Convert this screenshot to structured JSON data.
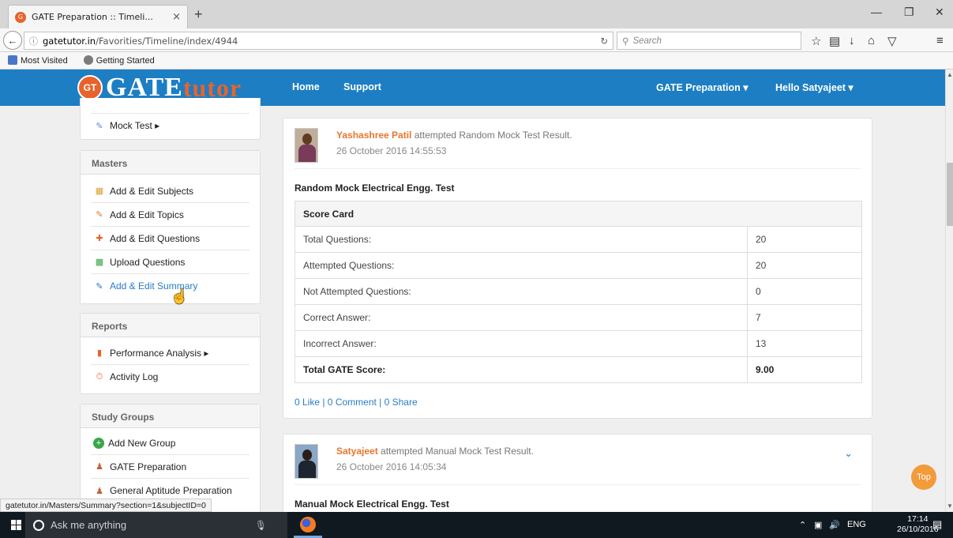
{
  "browser": {
    "tab_title": "GATE Preparation :: Timeli...",
    "tab_close": "×",
    "new_tab": "+",
    "url_host": "gatetutor.in",
    "url_path": "/Favorities/Timeline/index/4944",
    "search_placeholder": "Search",
    "bookmarks": [
      "Most Visited",
      "Getting Started"
    ]
  },
  "site": {
    "logo_badge": "GT",
    "logo_gate": "GATE",
    "logo_tutor": "tutor",
    "nav": {
      "home": "Home",
      "support": "Support",
      "gate_prep": "GATE Preparation ▾",
      "user": "Hello Satyajeet ▾"
    }
  },
  "sidebar": {
    "top_item": "Mock Test ▸",
    "masters": {
      "heading": "Masters",
      "items": [
        "Add & Edit Subjects",
        "Add & Edit Topics",
        "Add & Edit Questions",
        "Upload Questions",
        "Add & Edit Summary"
      ]
    },
    "reports": {
      "heading": "Reports",
      "items": [
        "Performance Analysis ▸",
        "Activity Log"
      ]
    },
    "study_groups": {
      "heading": "Study Groups",
      "items": [
        "Add New Group",
        "GATE Preparation",
        "General Aptitude Preparation"
      ]
    }
  },
  "feed": {
    "post1": {
      "user": "Yashashree Patil",
      "action": " attempted Random Mock Test Result.",
      "timestamp": "26 October 2016 14:55:53",
      "test_title": "Random Mock Electrical Engg. Test",
      "table_header": "Score Card",
      "rows": [
        {
          "label": "Total Questions:",
          "value": "20"
        },
        {
          "label": "Attempted Questions:",
          "value": "20"
        },
        {
          "label": "Not Attempted Questions:",
          "value": "0"
        },
        {
          "label": "Correct Answer:",
          "value": "7"
        },
        {
          "label": "Incorrect Answer:",
          "value": "13"
        },
        {
          "label": "Total GATE Score:",
          "value": "9.00"
        }
      ],
      "actions": "0 Like | 0 Comment | 0 Share"
    },
    "post2": {
      "user": "Satyajeet",
      "action": " attempted Manual Mock Test Result.",
      "timestamp": "26 October 2016 14:05:34",
      "test_title": "Manual Mock Electrical Engg. Test"
    }
  },
  "top_button": "Top",
  "status_url": "gatetutor.in/Masters/Summary?section=1&subjectID=0",
  "taskbar": {
    "search_placeholder": "Ask me anything",
    "lang": "ENG",
    "time": "17:14",
    "date": "26/10/2016"
  }
}
